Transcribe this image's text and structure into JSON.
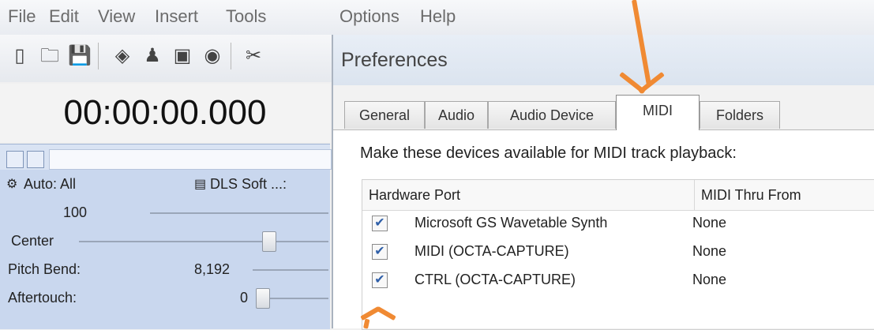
{
  "menu": [
    "File",
    "Edit",
    "View",
    "Insert",
    "Tools",
    "Options",
    "Help"
  ],
  "toolbar": {
    "icons": [
      "new-file-icon",
      "open-folder-icon",
      "save-icon",
      "record-icon",
      "person-icon",
      "notes-icon",
      "zoom-icon",
      "cut-icon"
    ]
  },
  "time": "00:00:00.000",
  "track_panel": {
    "auto_label": "Auto: All",
    "device_label": "DLS Soft ...:",
    "volume_value": "100",
    "pan_label": "Center",
    "pitch_label": "Pitch Bend:",
    "pitch_value": "8,192",
    "aftertouch_label": "Aftertouch:",
    "aftertouch_value": "0"
  },
  "preferences": {
    "title": "Preferences",
    "tabs": [
      "General",
      "Audio",
      "Audio Device",
      "MIDI",
      "Folders"
    ],
    "active_tab": "MIDI",
    "caption": "Make these devices available for MIDI track playback:",
    "columns": [
      "Hardware Port",
      "MIDI Thru From"
    ],
    "rows": [
      {
        "checked": true,
        "port": "Microsoft GS Wavetable Synth",
        "thru": "None"
      },
      {
        "checked": true,
        "port": "MIDI (OCTA-CAPTURE)",
        "thru": "None"
      },
      {
        "checked": true,
        "port": "CTRL (OCTA-CAPTURE)",
        "thru": "None"
      }
    ]
  },
  "colors": {
    "annotation_arrow": "#f08a33",
    "track_panel_bg": "#c9d7ee",
    "checkbox_check": "#2f5fa8"
  }
}
